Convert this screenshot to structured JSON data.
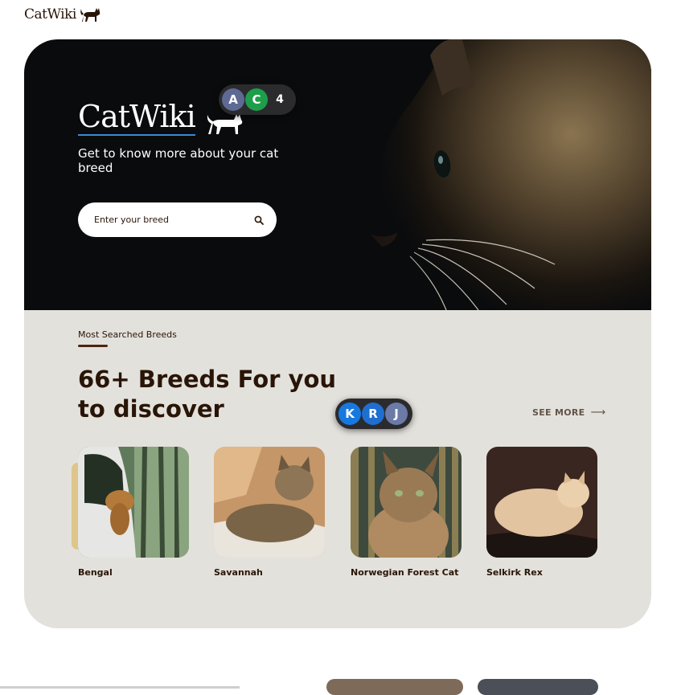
{
  "brand": {
    "name": "CatWiki"
  },
  "hero": {
    "tagline": "Get to know more about your cat breed",
    "search_placeholder": "Enter your breed"
  },
  "presence_top": {
    "avatars": [
      "A",
      "C"
    ],
    "extra_count": "4",
    "colors": [
      "#5e6a93",
      "#1e9e4a"
    ]
  },
  "presence_mid": {
    "avatars": [
      "K",
      "R",
      "J"
    ],
    "colors": [
      "#1779e0",
      "#1f6ed0",
      "#6b7aa6"
    ]
  },
  "breeds": {
    "section_label": "Most Searched Breeds",
    "heading": "66+ Breeds For you to discover",
    "see_more": "SEE MORE",
    "items": [
      {
        "name": "Bengal"
      },
      {
        "name": "Savannah"
      },
      {
        "name": "Norwegian Forest Cat"
      },
      {
        "name": "Selkirk Rex"
      }
    ]
  },
  "colors": {
    "brand_dark": "#291507",
    "hero_bg": "#0a0b0d",
    "section_bg": "#e3e1dc",
    "accent": "#dec68b"
  }
}
